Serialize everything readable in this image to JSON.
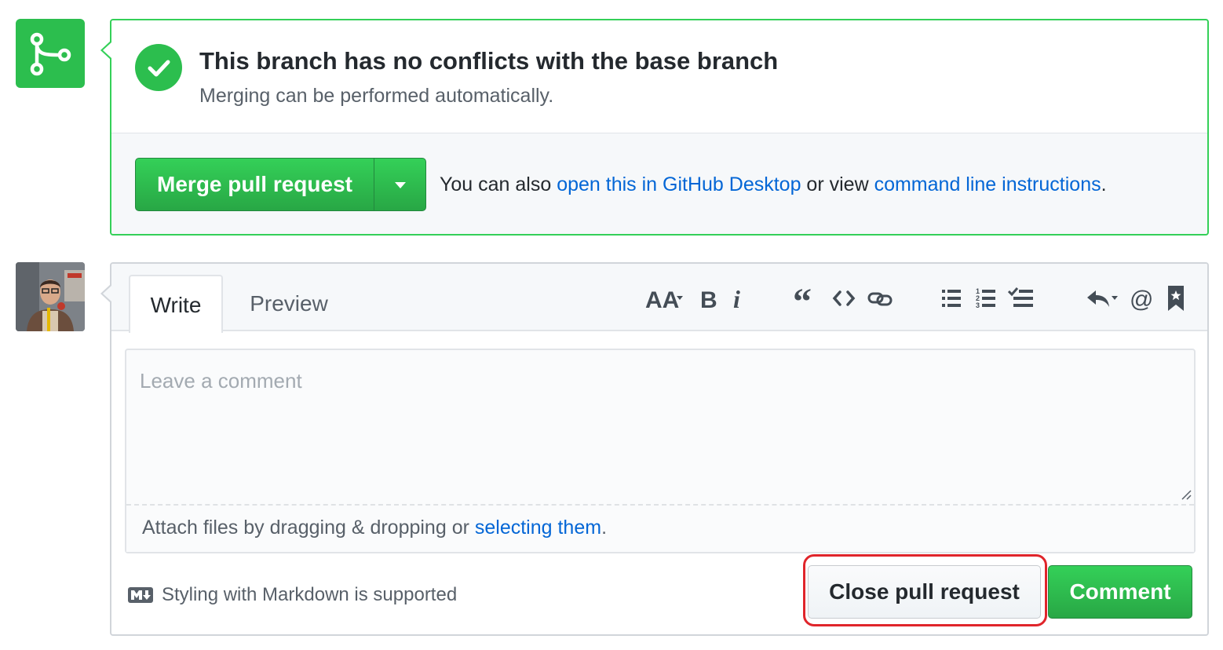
{
  "merge_status": {
    "title": "This branch has no conflicts with the base branch",
    "subtitle": "Merging can be performed automatically.",
    "merge_button_label": "Merge pull request",
    "alt_prefix": "You can also ",
    "desktop_link": "open this in GitHub Desktop",
    "alt_middle": " or view ",
    "cli_link": "command line instructions",
    "alt_suffix": ".",
    "icon": "git-merge-icon",
    "accent_color": "#2cbe4e",
    "border_color": "#34d058"
  },
  "comment_form": {
    "tabs": [
      {
        "label": "Write",
        "active": true
      },
      {
        "label": "Preview",
        "active": false
      }
    ],
    "toolbar": [
      "text-size-icon",
      "bold-icon",
      "italic-icon",
      "quote-icon",
      "code-icon",
      "link-icon",
      "unordered-list-icon",
      "ordered-list-icon",
      "task-list-icon",
      "reply-icon",
      "mention-icon",
      "bookmark-icon"
    ],
    "placeholder": "Leave a comment",
    "attach_prefix": "Attach files by dragging & dropping or ",
    "attach_link": "selecting them",
    "attach_suffix": ".",
    "markdown_note": "Styling with Markdown is supported",
    "markdown_icon": "markdown-icon",
    "close_button": "Close pull request",
    "comment_button": "Comment",
    "highlight_color": "#e0252b"
  },
  "colors": {
    "link": "#0366d6",
    "green": "#28a745",
    "muted_text": "#586069"
  }
}
